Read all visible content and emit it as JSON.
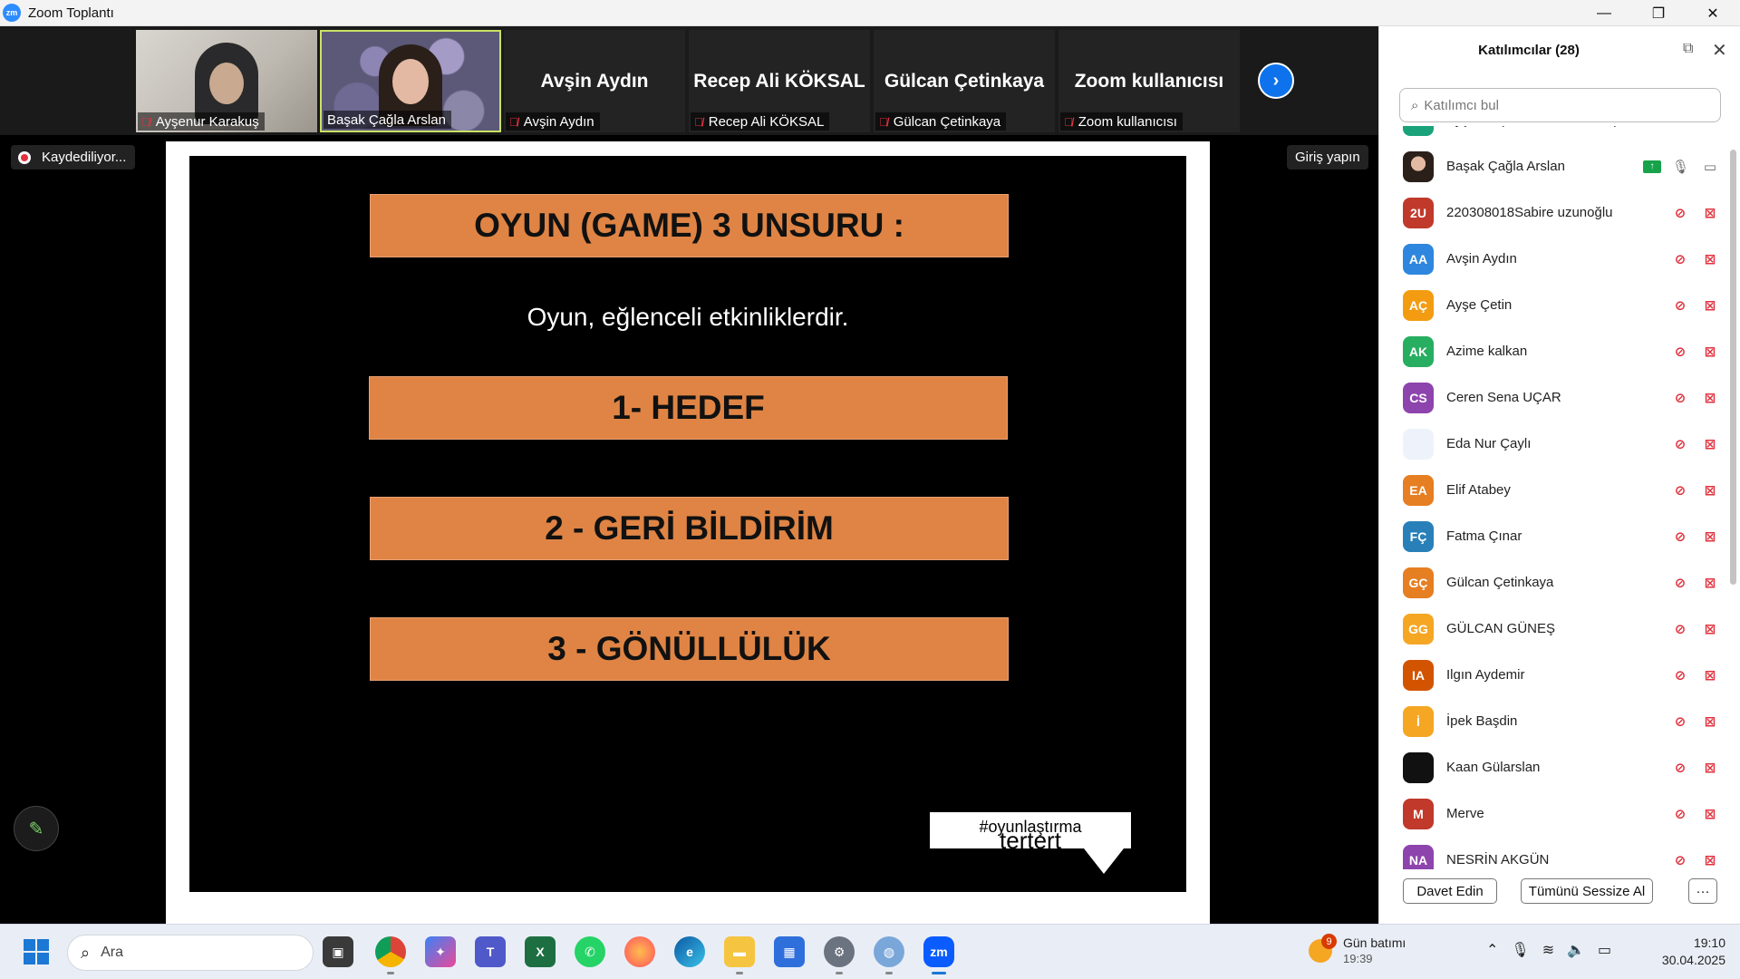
{
  "window": {
    "logo_text": "zm",
    "title": "Zoom Toplantı",
    "minimize": "—",
    "restore": "❐",
    "close": "✕"
  },
  "video_strip": {
    "tiles": [
      {
        "name": "Ayşenur Karakuş",
        "type": "video"
      },
      {
        "name": "Başak Çağla Arslan",
        "type": "video"
      },
      {
        "name": "Avşin Aydın",
        "type": "name"
      },
      {
        "name": "Recep Ali KÖKSAL",
        "type": "name"
      },
      {
        "name": "Gülcan Çetinkaya",
        "type": "name"
      },
      {
        "name": "Zoom kullanıcısı",
        "type": "name"
      }
    ],
    "next_icon": "›"
  },
  "recording": {
    "label": "Kaydediliyor..."
  },
  "signin": {
    "label": "Giriş yapın"
  },
  "slide": {
    "title": "OYUN (GAME) 3 UNSURU :",
    "subtitle": "Oyun, eğlenceli etkinliklerdir.",
    "item1": "1- HEDEF",
    "item2": "2 - GERİ BİLDİRİM",
    "item3": "3 - GÖNÜLLÜLÜK",
    "hashtag": "#oyunlaştırma",
    "hashtag_sub": "tertert"
  },
  "participants": {
    "title": "Katılımcılar (28)",
    "search_placeholder": "Katılımcı bul",
    "list": [
      {
        "initials": "",
        "name": "Ayşenur (Ortam Sahibi, ben)",
        "color": "#1aa37a",
        "mic": "off",
        "cam": "off"
      },
      {
        "initials": "",
        "name": "Başak Çağla Arslan",
        "color": "photo",
        "mic": "on",
        "cam": "on",
        "share": true
      },
      {
        "initials": "2U",
        "name": "220308018Sabire uzunoğlu",
        "color": "#c0392b",
        "mic": "off",
        "cam": "off"
      },
      {
        "initials": "AA",
        "name": "Avşin Aydın",
        "color": "#2e86de",
        "mic": "off",
        "cam": "off"
      },
      {
        "initials": "AÇ",
        "name": "Ayşe Çetin",
        "color": "#f39c12",
        "mic": "off",
        "cam": "off"
      },
      {
        "initials": "AK",
        "name": "Azime kalkan",
        "color": "#27ae60",
        "mic": "off",
        "cam": "off"
      },
      {
        "initials": "CS",
        "name": "Ceren Sena UÇAR",
        "color": "#8e44ad",
        "mic": "off",
        "cam": "off"
      },
      {
        "initials": "",
        "name": "Eda Nur Çaylı",
        "color": "#eef2fb",
        "mic": "off",
        "cam": "off"
      },
      {
        "initials": "EA",
        "name": "Elif Atabey",
        "color": "#e67e22",
        "mic": "off",
        "cam": "off"
      },
      {
        "initials": "FÇ",
        "name": "Fatma Çınar",
        "color": "#2980b9",
        "mic": "off",
        "cam": "off"
      },
      {
        "initials": "GÇ",
        "name": "Gülcan Çetinkaya",
        "color": "#e67e22",
        "mic": "off",
        "cam": "off"
      },
      {
        "initials": "GG",
        "name": "GÜLCAN GÜNEŞ",
        "color": "#f5a623",
        "mic": "off",
        "cam": "off"
      },
      {
        "initials": "IA",
        "name": "Ilgın Aydemir",
        "color": "#d35400",
        "mic": "off",
        "cam": "off"
      },
      {
        "initials": "İ",
        "name": "İpek Başdin",
        "color": "#f5a623",
        "mic": "off",
        "cam": "off"
      },
      {
        "initials": "",
        "name": "Kaan Gülarslan",
        "color": "#111111",
        "mic": "off",
        "cam": "off"
      },
      {
        "initials": "M",
        "name": "Merve",
        "color": "#c0392b",
        "mic": "off",
        "cam": "off"
      },
      {
        "initials": "NA",
        "name": "NESRİN AKGÜN",
        "color": "#8e44ad",
        "mic": "off",
        "cam": "off"
      }
    ],
    "invite": "Davet Edin",
    "mute_all": "Tümünü Sessize Al",
    "more": "···"
  },
  "taskbar": {
    "search_placeholder": "Ara",
    "weather_count": "9",
    "weather_title": "Gün batımı",
    "weather_time": "19:39",
    "time": "19:10",
    "date": "30.04.2025"
  }
}
